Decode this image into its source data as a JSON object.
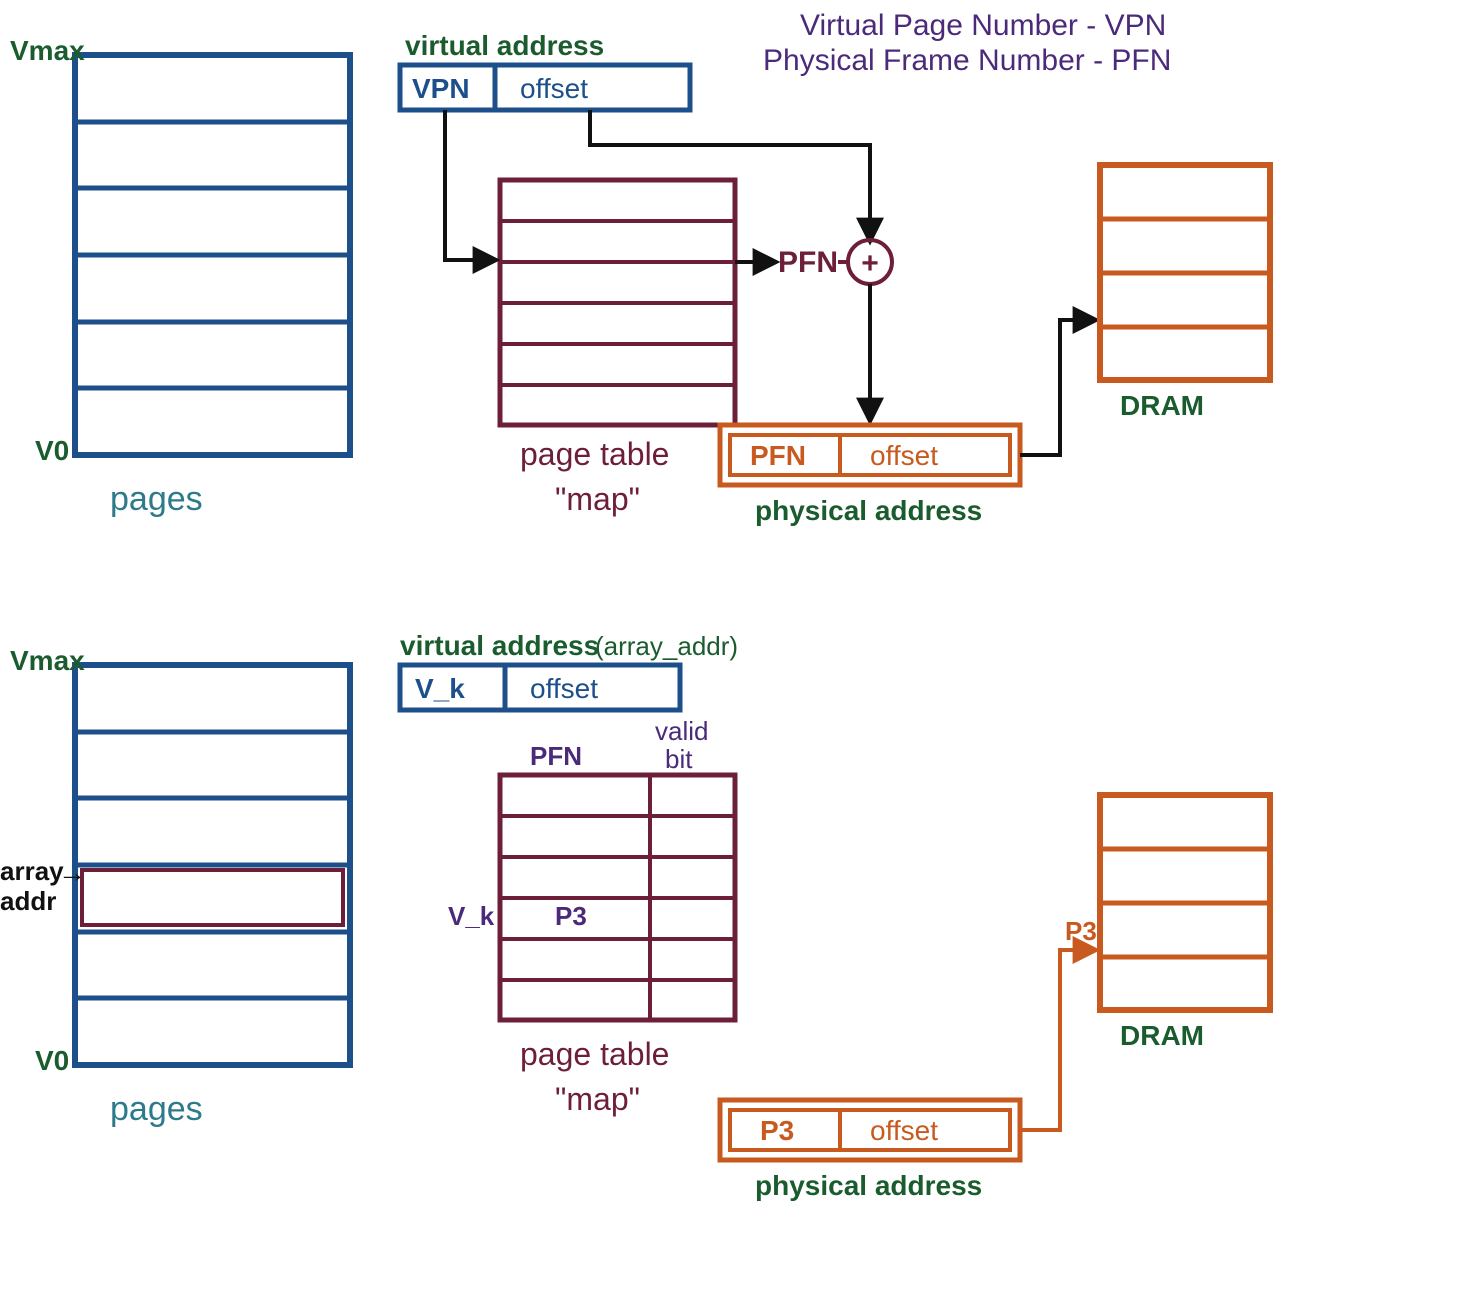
{
  "colors": {
    "blue": "#1d4f8b",
    "maroon": "#6d1f3a",
    "orange": "#c85a1f",
    "green": "#1a5c2e",
    "teal": "#2d7b8a",
    "purple": "#4b2a7a",
    "black": "#111111"
  },
  "notes": {
    "vpn_line": "Virtual Page Number - VPN",
    "pfn_line": "Physical Frame Number - PFN"
  },
  "top": {
    "vmax": "Vmax",
    "v0": "V0",
    "pages_label": "pages",
    "va_title": "virtual address",
    "va_vpn": "VPN",
    "va_off": "offset",
    "pfn_text": "PFN",
    "plus": "+",
    "pt_line1": "page table",
    "pt_line2": "\"map\"",
    "pa_pfn": "PFN",
    "pa_off": "offset",
    "pa_title": "physical address",
    "dram": "DRAM"
  },
  "bot": {
    "vmax": "Vmax",
    "v0": "V0",
    "pages_label": "pages",
    "array_l1": "array",
    "array_l2": "addr",
    "array_arrow": "→",
    "va_title_1": "virtual address",
    "va_title_2": "(array_addr)",
    "va_vk": "V_k",
    "va_off": "offset",
    "col_pfn": "PFN",
    "col_valid_1": "valid",
    "col_valid_2": "bit",
    "row_label": "V_k",
    "row_val": "P3",
    "pt_line1": "page table",
    "pt_line2": "\"map\"",
    "pa_p3": "P3",
    "pa_off": "offset",
    "pa_title": "physical address",
    "dram": "DRAM",
    "p3_arrow": "P3"
  }
}
